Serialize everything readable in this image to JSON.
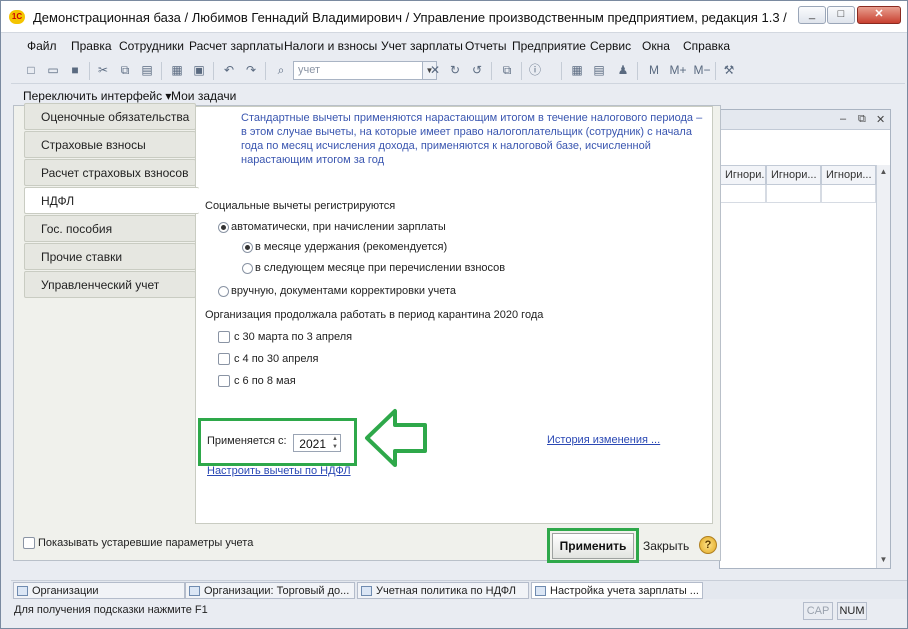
{
  "window": {
    "title": "Демонстрационная база / Любимов Геннадий Владимирович /  Управление производственным предприятием, редакция 1.3 /",
    "min_label": "_",
    "max_label": "□",
    "close_label": "✕"
  },
  "menu": [
    "Файл",
    "Правка",
    "Сотрудники",
    "Расчет зарплаты",
    "Налоги и взносы",
    "Учет зарплаты",
    "Отчеты",
    "Предприятие",
    "Сервис",
    "Окна",
    "Справка"
  ],
  "toolbar": {
    "search_value": "учет",
    "mem_buttons": [
      "M",
      "M+",
      "M−"
    ]
  },
  "toolbar2": {
    "switch_interface": "Переключить интерфейс ▾",
    "my_tasks": "Мои задачи"
  },
  "background_window": {
    "columns": [
      "Игнори...",
      "Игнори...",
      "Игнори..."
    ]
  },
  "tabs": [
    {
      "label": "Оценочные обязательства"
    },
    {
      "label": "Страховые взносы"
    },
    {
      "label": "Расчет страховых взносов"
    },
    {
      "label": "НДФЛ"
    },
    {
      "label": "Гос. пособия"
    },
    {
      "label": "Прочие ставки"
    },
    {
      "label": "Управленческий учет"
    }
  ],
  "panel": {
    "info_text": "Стандартные вычеты применяются нарастающим итогом в течение налогового периода – в этом случае вычеты, на которые имеет право налогоплательщик (сотрудник) с начала года по месяц исчисления дохода, применяются к налоговой базе, исчисленной нарастающим итогом за год",
    "social_title": "Социальные вычеты регистрируются",
    "radio_auto": "автоматически, при начислении зарплаты",
    "radio_month_hold": "в месяце удержания (рекомендуется)",
    "radio_next_month": "в следующем месяце при перечислении взносов",
    "radio_manual": "вручную, документами корректировки учета",
    "quarantine_title": "Организация продолжала работать в период карантина 2020 года",
    "check_1": "с 30 марта по 3 апреля",
    "check_2": "с 4 по 30 апреля",
    "check_3": "с 6 по 8 мая",
    "applies_from_label": "Применяется с:",
    "applies_from_value": "2021",
    "history_link": "История изменения ...",
    "configure_link": "Настроить вычеты по НДФЛ"
  },
  "footer": {
    "show_obsolete": "Показывать устаревшие параметры учета",
    "apply_button": "Применить",
    "close_button": "Закрыть",
    "help": "?"
  },
  "taskbar": [
    {
      "label": "Организации"
    },
    {
      "label": "Организации: Торговый до..."
    },
    {
      "label": "Учетная политика по НДФЛ"
    },
    {
      "label": "Настройка учета зарплаты ..."
    }
  ],
  "status": {
    "hint": "Для получения подсказки нажмите F1",
    "cap": "CAP",
    "num": "NUM"
  },
  "colors": {
    "highlight_green": "#2ea84a",
    "link_blue": "#2a48b4"
  }
}
